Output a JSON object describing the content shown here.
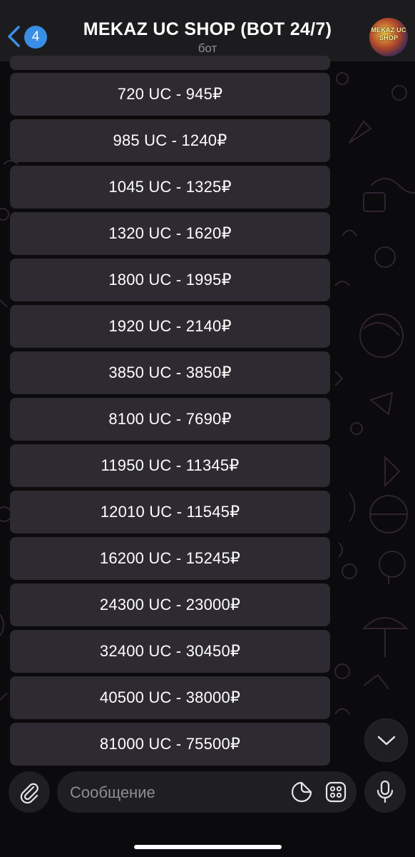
{
  "header": {
    "back_badge": "4",
    "title": "MEKAZ UC SHOP (BOT 24/7)",
    "subtitle": "бот",
    "avatar_text": "MEKAZ UC SHOP"
  },
  "keyboard": {
    "buttons": [
      "720 UC - 945₽",
      "985 UC - 1240₽",
      "1045 UC - 1325₽",
      "1320 UC - 1620₽",
      "1800 UC - 1995₽",
      "1920 UC - 2140₽",
      "3850 UC - 3850₽",
      "8100 UC - 7690₽",
      "11950 UC - 11345₽",
      "12010 UC - 11545₽",
      "16200 UC - 15245₽",
      "24300 UC - 23000₽",
      "32400 UC - 30450₽",
      "40500 UC - 38000₽",
      "81000 UC - 75500₽"
    ]
  },
  "composer": {
    "placeholder": "Сообщение"
  },
  "icons": {
    "back": "chevron-left-icon",
    "attach": "paperclip-icon",
    "sticker": "sticker-icon",
    "bot_menu": "bot-command-menu-icon",
    "mic": "microphone-icon",
    "scroll_down": "chevron-down-icon"
  },
  "colors": {
    "accent": "#3a8ee6",
    "header_bg": "#1c1c1e",
    "button_bg": "#2e2a31",
    "background": "#0b0a0c"
  }
}
